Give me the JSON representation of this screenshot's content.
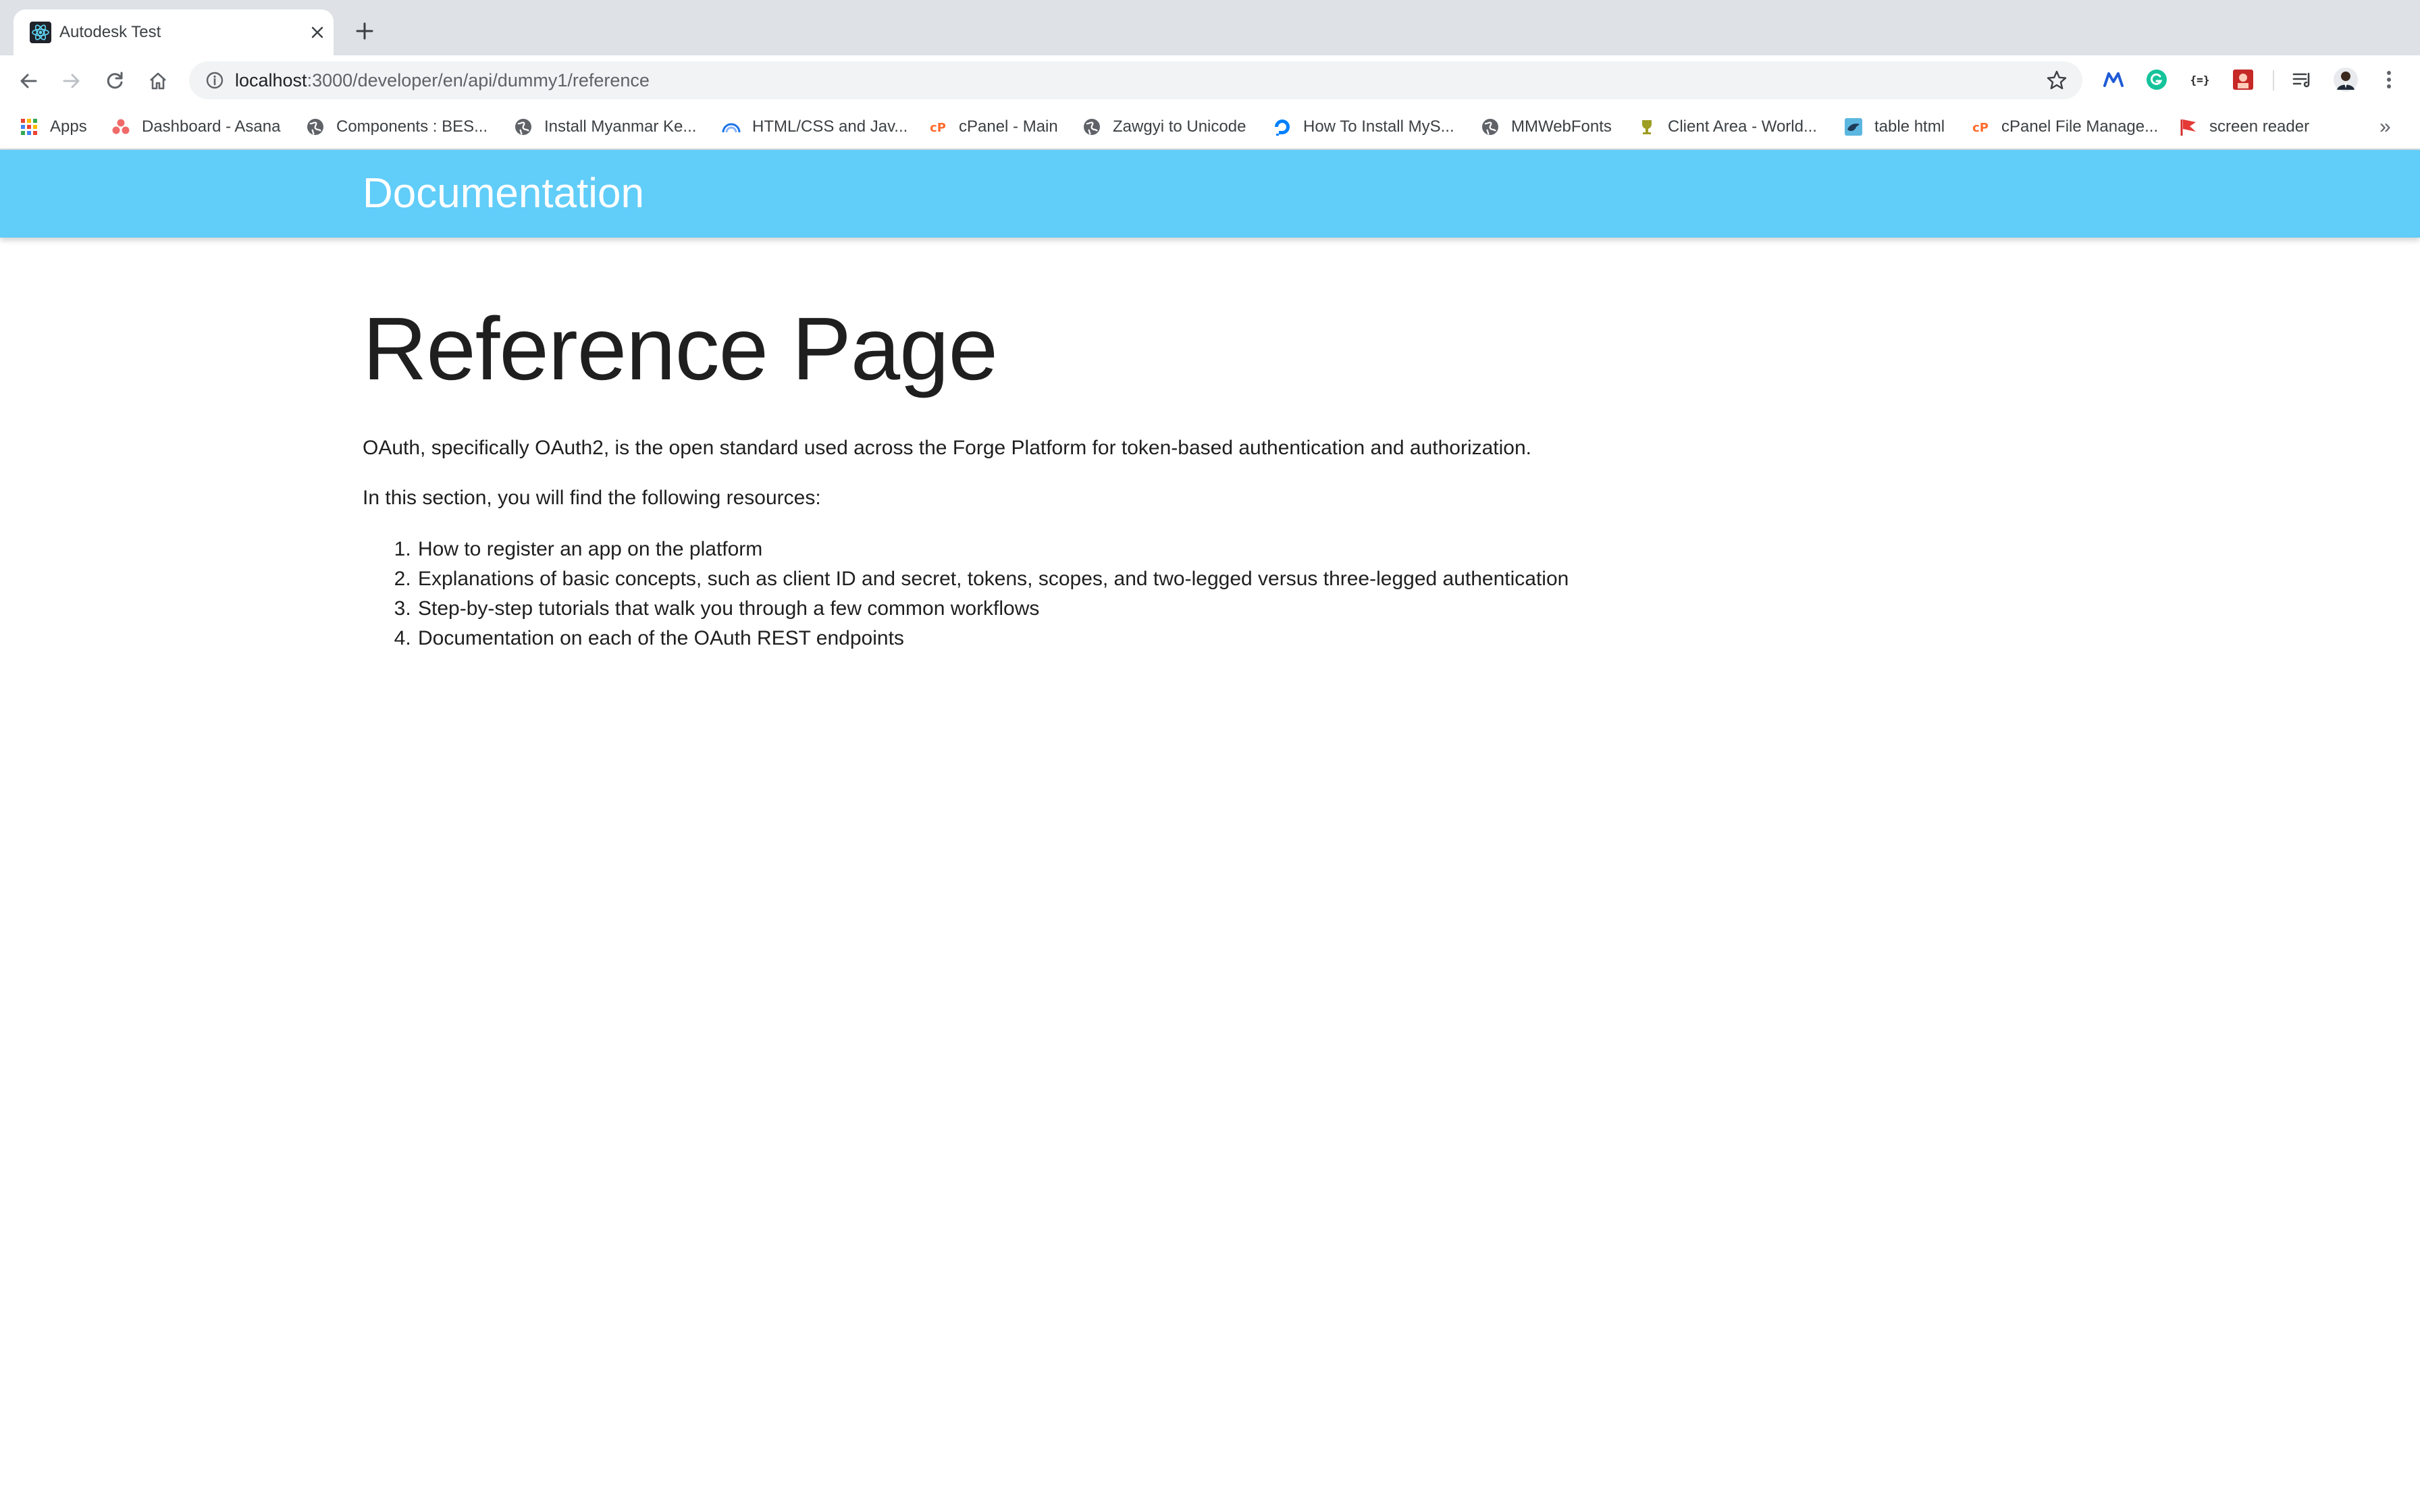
{
  "browser": {
    "tab": {
      "title": "Autodesk Test",
      "favicon": "react-icon"
    },
    "new_tab_icon": "plus-icon",
    "address_bar": {
      "host": "localhost",
      "path": ":3000/developer/en/api/dummy1/reference"
    },
    "bookmarks": [
      {
        "label": "Apps",
        "icon": "apps-grid-icon"
      },
      {
        "label": "Dashboard - Asana",
        "icon": "asana-icon"
      },
      {
        "label": "Components : BES...",
        "icon": "globe-icon"
      },
      {
        "label": "Install Myanmar Ke...",
        "icon": "globe-icon"
      },
      {
        "label": "HTML/CSS and Jav...",
        "icon": "rainbow-icon"
      },
      {
        "label": "cPanel - Main",
        "icon": "cpanel-icon"
      },
      {
        "label": "Zawgyi to Unicode",
        "icon": "globe-icon"
      },
      {
        "label": "How To Install MyS...",
        "icon": "digitalocean-icon"
      },
      {
        "label": "MMWebFonts",
        "icon": "globe-icon"
      },
      {
        "label": "Client Area - World...",
        "icon": "trophy-icon"
      },
      {
        "label": "table html",
        "icon": "bird-icon"
      },
      {
        "label": "cPanel File Manage...",
        "icon": "cpanel-icon"
      },
      {
        "label": "screen reader",
        "icon": "flag-icon"
      }
    ],
    "colors": {
      "tabstrip": "#dee1e6",
      "omnibox": "#f1f3f4"
    }
  },
  "site": {
    "header_title": "Documentation",
    "header_color": "#61cdf9"
  },
  "content": {
    "heading": "Reference Page",
    "intro": "OAuth, specifically OAuth2, is the open standard used across the Forge Platform for token-based authentication and authorization.",
    "lead": "In this section, you will find the following resources:",
    "resources": [
      "How to register an app on the platform",
      "Explanations of basic concepts, such as client ID and secret, tokens, scopes, and two-legged versus three-legged authentication",
      "Step-by-step tutorials that walk you through a few common workflows",
      "Documentation on each of the OAuth REST endpoints"
    ]
  }
}
